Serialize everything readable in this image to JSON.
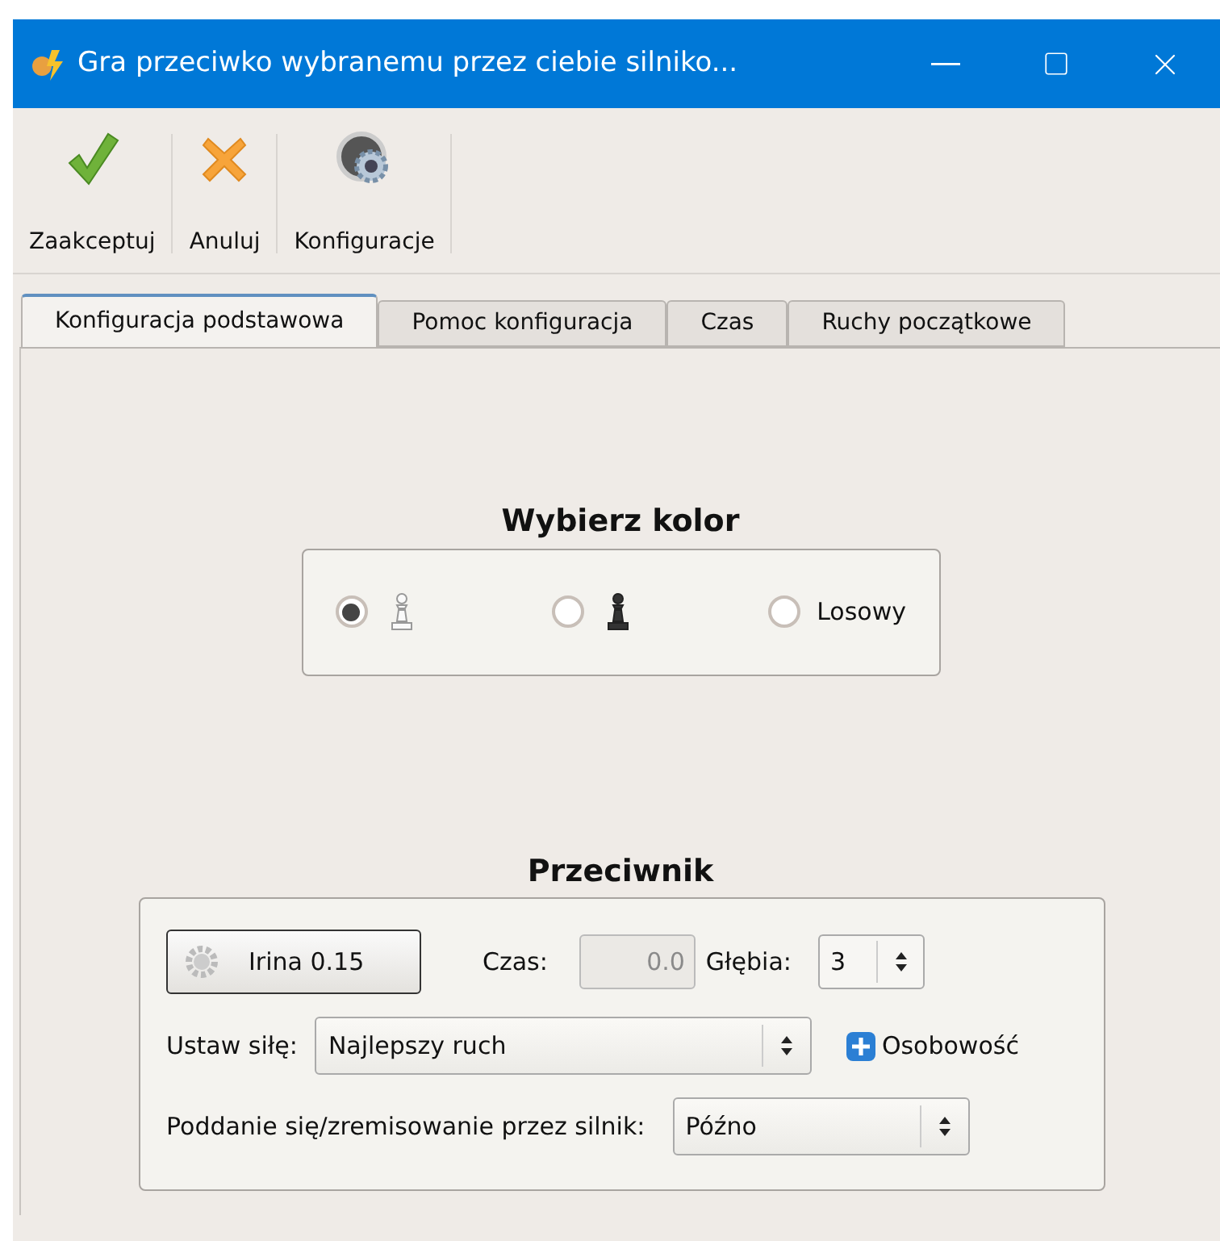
{
  "window": {
    "title": "Gra przeciwko wybranemu przez ciebie silniko..."
  },
  "toolbar": [
    {
      "kind": "accept",
      "label": "Zaakceptuj"
    },
    {
      "kind": "cancel",
      "label": "Anuluj"
    },
    {
      "kind": "config",
      "label": "Konfiguracje"
    }
  ],
  "tabs": [
    {
      "label": "Konfiguracja podstawowa",
      "selected": true
    },
    {
      "label": "Pomoc konfiguracja",
      "selected": false
    },
    {
      "label": "Czas",
      "selected": false
    },
    {
      "label": "Ruchy początkowe",
      "selected": false
    }
  ],
  "color_group": {
    "title": "Wybierz kolor",
    "options": [
      {
        "kind": "white-pawn",
        "selected": true
      },
      {
        "kind": "black-pawn",
        "selected": false
      },
      {
        "kind": "text",
        "label": "Losowy",
        "selected": false
      }
    ]
  },
  "opponent_group": {
    "title": "Przeciwnik",
    "engine_button": "Irina 0.15",
    "time_label": "Czas:",
    "time_value": "0.0",
    "time_disabled": true,
    "depth_label": "Głębia:",
    "depth_value": "3",
    "strength_label": "Ustaw siłę:",
    "strength_value": "Najlepszy ruch",
    "personality_label": "Osobowość",
    "resign_label": "Poddanie się/zremisowanie przez silnik:",
    "resign_value": "Późno"
  }
}
